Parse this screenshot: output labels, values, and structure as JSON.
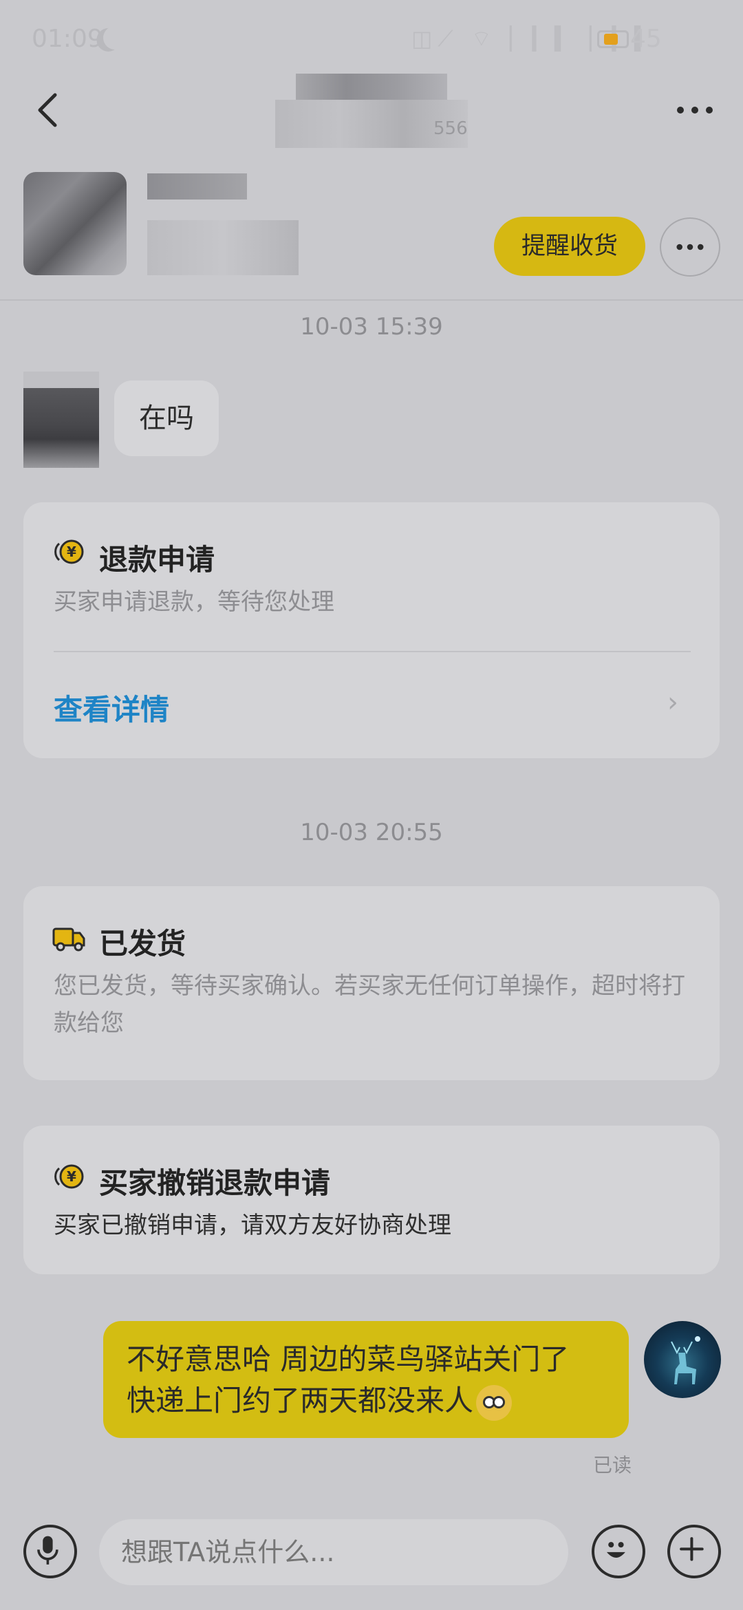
{
  "status_bar": {
    "time": "01:09",
    "battery_percent": "45",
    "icons": "◫⟋ ⌔ ▏▎▍ ▏▎▍",
    "battery_color": "#e3a01d"
  },
  "header": {
    "subtitle_suffix": "556"
  },
  "product": {
    "remind_label": "提醒收货"
  },
  "messages": {
    "ts1": "10-03 15:39",
    "left_text": "在吗",
    "ts2": "10-03 20:55"
  },
  "cards": {
    "refund": {
      "title": "退款申请",
      "text": "买家申请退款，等待您处理",
      "link": "查看详情",
      "chevron": "›",
      "icon": "refund-yen-icon"
    },
    "shipped": {
      "title": "已发货",
      "text": "您已发货，等待买家确认。若买家无任何订单操作，超时将打款给您",
      "icon": "delivery-truck-icon"
    },
    "cancel_refund": {
      "title": "买家撤销退款申请",
      "text": "买家已撤销申请，请双方友好协商处理",
      "icon": "refund-yen-icon"
    }
  },
  "outgoing": {
    "line1": "不好意思哈 周边的菜鸟驿站关门了",
    "line2": "快递上门约了两天都没来人",
    "read_status": "已读"
  },
  "input_bar": {
    "placeholder": "想跟TA说点什么..."
  },
  "colors": {
    "accent_yellow": "#d6b812",
    "link_blue": "#1e84c6",
    "background": "#c9c9cd"
  }
}
